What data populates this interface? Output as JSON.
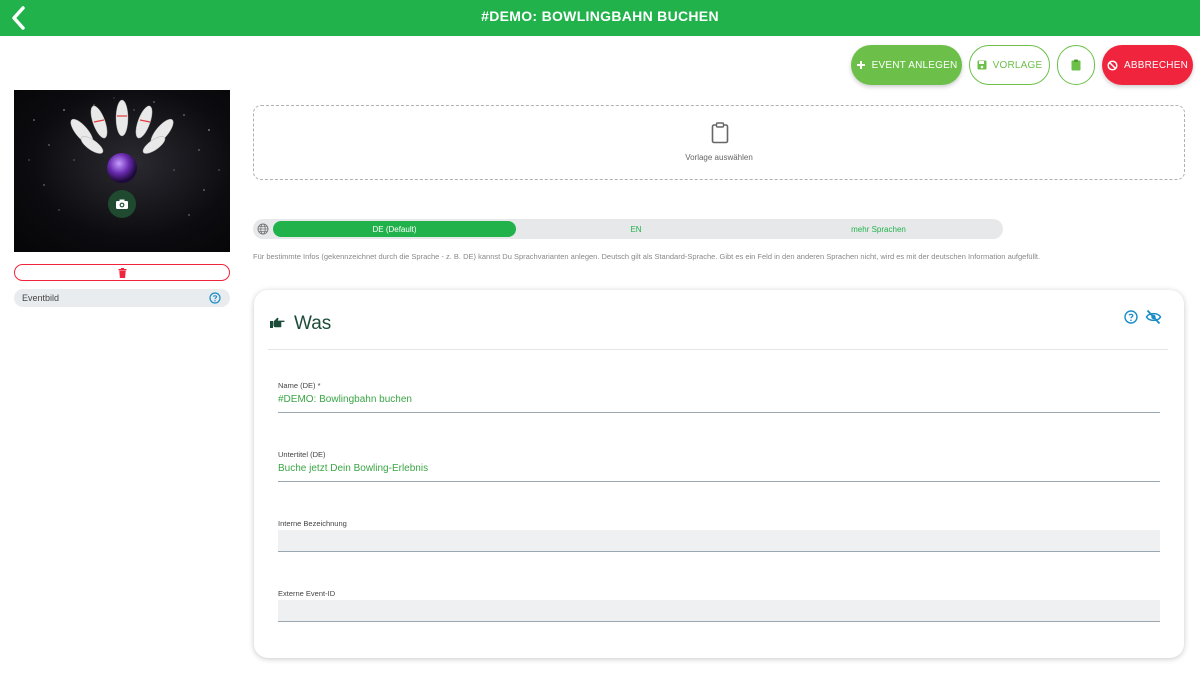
{
  "header": {
    "title": "#DEMO: BOWLINGBAHN BUCHEN"
  },
  "toolbar": {
    "event_anlegen": "EVENT ANLEGEN",
    "vorlage": "VORLAGE",
    "abbrechen": "ABBRECHEN"
  },
  "image_panel": {
    "eventbild_label": "Eventbild"
  },
  "template_picker": {
    "label": "Vorlage auswählen"
  },
  "language": {
    "tabs": [
      "DE (Default)",
      "EN",
      "mehr Sprachen"
    ],
    "active": "DE (Default)",
    "info": "Für bestimmte Infos (gekennzeichnet durch die Sprache - z. B. DE) kannst Du Sprachvarianten anlegen. Deutsch gilt als Standard-Sprache. Gibt es ein Feld in den anderen Sprachen nicht, wird es mit der deutschen Information aufgefüllt."
  },
  "was_card": {
    "title": "Was",
    "fields": [
      {
        "label": "Name (DE) *",
        "value": "#DEMO: Bowlingbahn buchen"
      },
      {
        "label": "Untertitel (DE)",
        "value": "Buche jetzt Dein Bowling-Erlebnis"
      },
      {
        "label": "Interne Bezeichnung",
        "value": ""
      },
      {
        "label": "Externe Event-ID",
        "value": ""
      }
    ]
  },
  "colors": {
    "brand_green": "#22b24c",
    "button_green": "#6cc04a",
    "danger_red": "#f0243d",
    "title_dark_green": "#1d4d3a",
    "link_blue": "#1a8cc8"
  },
  "icons": {
    "back": "chevron-left-icon",
    "add": "plus-icon",
    "save": "floppy-disk-icon",
    "clipboard": "clipboard-icon",
    "cancel": "ban-icon",
    "camera": "camera-icon",
    "delete": "trash-icon",
    "help": "question-circle-icon",
    "language": "globe-icon",
    "section": "pointing-hand-icon",
    "visibility": "eye-slash-icon"
  }
}
